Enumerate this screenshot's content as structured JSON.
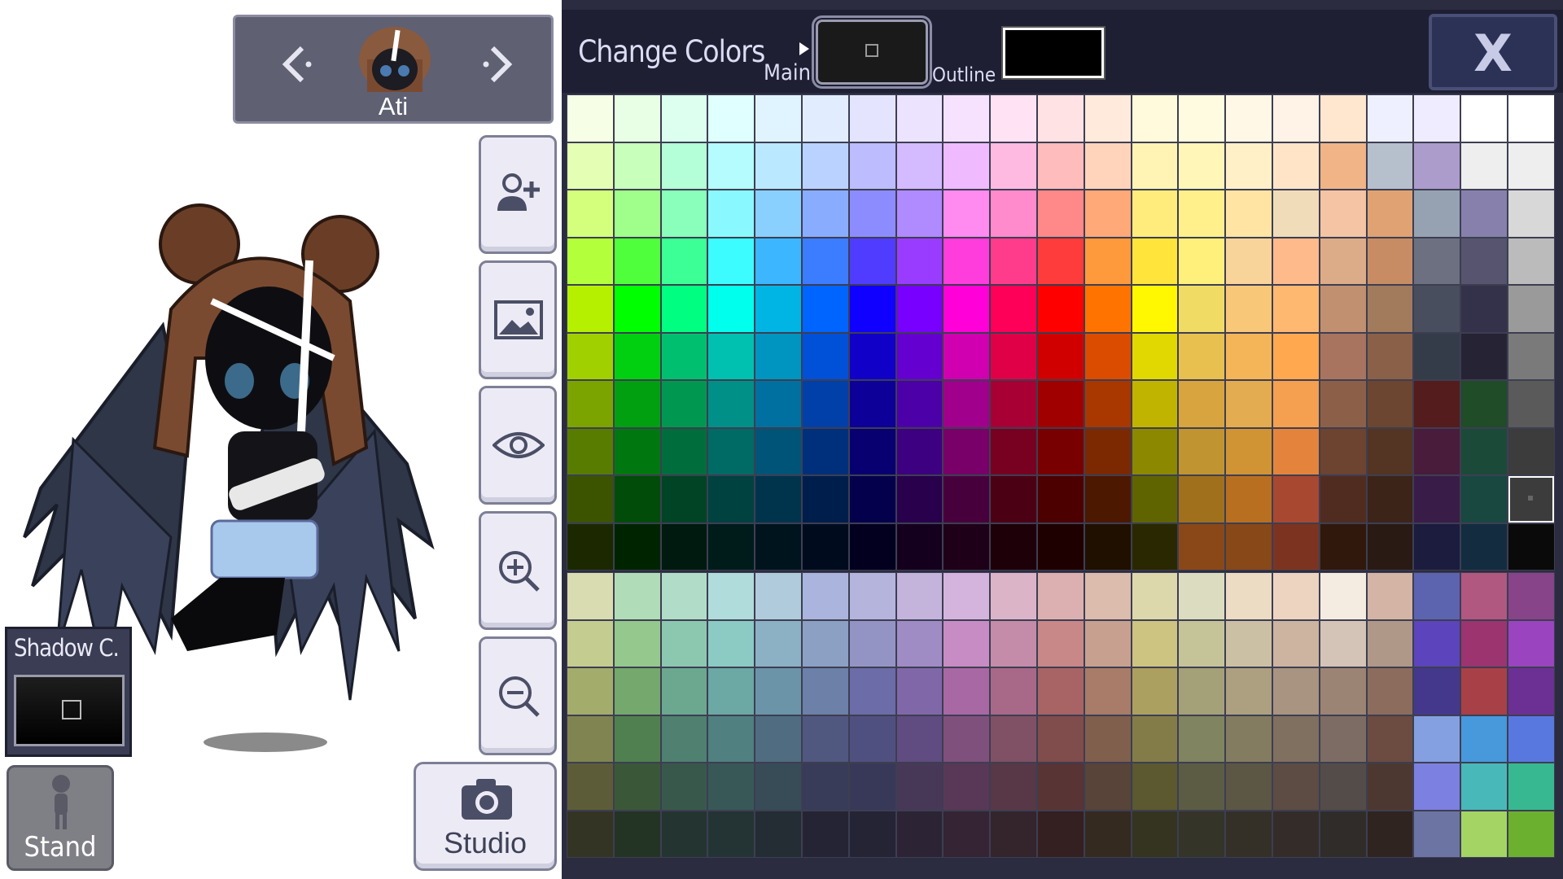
{
  "character_nav": {
    "name": "Ati"
  },
  "side_tools": [
    "add-character",
    "background",
    "visibility",
    "zoom-in",
    "zoom-out"
  ],
  "studio": {
    "label": "Studio"
  },
  "shadow": {
    "label": "Shadow C.",
    "color": "#000000"
  },
  "stand": {
    "label": "Stand"
  },
  "color_panel": {
    "title": "Change Colors",
    "main_label": "Main",
    "main_color": "#1a1a1a",
    "outline_label": "Outline",
    "outline_color": "#000000",
    "close_label": "X",
    "selected_color": {
      "row": 8,
      "col": 20
    },
    "palette_rows": [
      [
        "#f6ffe6",
        "#e8ffe6",
        "#dcfff0",
        "#e0ffff",
        "#e0f4ff",
        "#e2ecff",
        "#e4e4ff",
        "#ece4ff",
        "#f6e2ff",
        "#ffe2f4",
        "#ffe2e4",
        "#ffeadc",
        "#fffadc",
        "#fffbe0",
        "#fff8e6",
        "#fff2e6",
        "#ffe6ce",
        "#eef0ff",
        "#f0ecff",
        "#ffffff"
      ],
      [
        "#e4ffb4",
        "#c8ffba",
        "#b4ffd8",
        "#b4fcff",
        "#bae8ff",
        "#bad2ff",
        "#bcbcff",
        "#d4baff",
        "#f0baff",
        "#ffbae2",
        "#ffbcbc",
        "#ffd4ba",
        "#fff4b4",
        "#fff6b8",
        "#fff0c8",
        "#ffe4c8",
        "#f0b486",
        "#b6bfcc",
        "#ac9ccc",
        "#eeeeee"
      ],
      [
        "#d4ff7c",
        "#a0ff8a",
        "#8affbc",
        "#8af8ff",
        "#8ad0ff",
        "#8aacff",
        "#8c8cff",
        "#b08aff",
        "#ff8af0",
        "#ff8acc",
        "#ff8888",
        "#ffa878",
        "#ffec7c",
        "#fff08c",
        "#ffe4a4",
        "#f0dcb8",
        "#f4c4a4",
        "#e0a272",
        "#96a2b2",
        "#8880ac"
      ],
      [
        "#b4ff3c",
        "#50ff3c",
        "#3cff96",
        "#3cfcff",
        "#3cb6ff",
        "#3c7cff",
        "#503cff",
        "#9a3cff",
        "#ff3cdc",
        "#ff3c8c",
        "#ff3c3c",
        "#ff9a3c",
        "#ffe43c",
        "#fff07c",
        "#f8d49a",
        "#ffba8c",
        "#dcac88",
        "#c88c64",
        "#6c7080",
        "#56546e"
      ],
      [
        "#b4f000",
        "#00ff00",
        "#00ff80",
        "#00ffec",
        "#00b4e4",
        "#0064ff",
        "#1000ff",
        "#7800ff",
        "#ff00d8",
        "#ff0058",
        "#ff0000",
        "#ff7400",
        "#fff800",
        "#f0dc64",
        "#f8c878",
        "#ffb870",
        "#c09070",
        "#a27a5c",
        "#484e5e",
        "#34324a"
      ],
      [
        "#a0d000",
        "#00d010",
        "#00c070",
        "#00c0b0",
        "#0094c0",
        "#0050d8",
        "#1000c8",
        "#6400d0",
        "#d000b0",
        "#e00048",
        "#d00000",
        "#dc4c00",
        "#e0d800",
        "#e8c050",
        "#f4b458",
        "#ffa850",
        "#a87460",
        "#8a6048",
        "#343c4a",
        "#262434"
      ],
      [
        "#7ca400",
        "#00a010",
        "#009850",
        "#009088",
        "#0070a0",
        "#0040a8",
        "#0c0098",
        "#4c00a8",
        "#a0008c",
        "#a80034",
        "#a00000",
        "#a83800",
        "#c0b400",
        "#d8a440",
        "#e4ac50",
        "#f4a050",
        "#8c6048",
        "#6c4630",
        "#541c1c",
        "#204c28"
      ],
      [
        "#587c00",
        "#007810",
        "#006e3c",
        "#006a64",
        "#005478",
        "#00307c",
        "#080070",
        "#3c0080",
        "#780068",
        "#780020",
        "#780000",
        "#7c2800",
        "#8c8800",
        "#c09430",
        "#d09434",
        "#e4843c",
        "#6c4430",
        "#543422",
        "#4a1c3c",
        "#1c4a38"
      ],
      [
        "#3c5400",
        "#004c08",
        "#004426",
        "#004240",
        "#00344c",
        "#001e4c",
        "#04004c",
        "#28004c",
        "#48003c",
        "#4c0014",
        "#4c0000",
        "#4c1800",
        "#606400",
        "#a0701c",
        "#b87020",
        "#a84830",
        "#502c20",
        "#3c2418",
        "#3a1c48",
        "#184840"
      ],
      [
        "#1c2800",
        "#002400",
        "#001a10",
        "#001c1a",
        "#00141e",
        "#000c1e",
        "#02001e",
        "#14001e",
        "#1e0018",
        "#1e0008",
        "#1e0000",
        "#201000",
        "#2a2800",
        "#8a4818",
        "#884818",
        "#7c3420",
        "#30180c",
        "#2a1a14",
        "#1c1c3e",
        "#142c40"
      ],
      [
        "#d8dcb0",
        "#b0dcb8",
        "#b0dcc8",
        "#b0dcdc",
        "#b0ccdc",
        "#aab4dc",
        "#b4b4dc",
        "#c4b4dc",
        "#d4b4dc",
        "#dcb4c8",
        "#dcb0b0",
        "#dcbcac",
        "#dcd8ac",
        "#dcdcc0",
        "#ecdcc4",
        "#ecd4c0",
        "#f4ece0",
        "#d4b4a4",
        "#5c64b0",
        "#b05880"
      ],
      [
        "#c4cc90",
        "#94c88c",
        "#8cc8b0",
        "#8ccac4",
        "#8cb0c4",
        "#8ca0c4",
        "#9494c4",
        "#a08cc4",
        "#c88cc4",
        "#c48ca8",
        "#c88888",
        "#c8a090",
        "#ccc480",
        "#c4c498",
        "#ccc0a4",
        "#ccb4a0",
        "#d4c4b8",
        "#b09888",
        "#5c44bc",
        "#9c3470"
      ],
      [
        "#a4ac6c",
        "#74a86c",
        "#6ca890",
        "#6ca8a4",
        "#6c94a8",
        "#6c80a8",
        "#6c6ca8",
        "#8068a8",
        "#a868a4",
        "#a86888",
        "#a86464",
        "#a87c68",
        "#aca060",
        "#a4a078",
        "#aca080",
        "#a89480",
        "#9c8474",
        "#8c6c5c",
        "#44388c",
        "#a84048"
      ],
      [
        "#808450",
        "#508050",
        "#508070",
        "#508080",
        "#506c80",
        "#505880",
        "#505080",
        "#604c80",
        "#80507c",
        "#805064",
        "#804c4c",
        "#80604c",
        "#847c48",
        "#808460",
        "#847c60",
        "#807060",
        "#7c6c64",
        "#6c4c40",
        "#84a0e0",
        "#4898dc"
      ],
      [
        "#5c5c38",
        "#3a5838",
        "#38584c",
        "#385858",
        "#384c58",
        "#383c58",
        "#383858",
        "#483858",
        "#583856",
        "#583846",
        "#583434",
        "#584438",
        "#5c5830",
        "#5c5c44",
        "#5c5644",
        "#5c4c44",
        "#544c48",
        "#4c3830",
        "#7c80e0",
        "#48b8b8"
      ],
      [
        "#343424",
        "#243424",
        "#243430",
        "#243434",
        "#242c34",
        "#242434",
        "#242434",
        "#2c2434",
        "#342434",
        "#34242c",
        "#342020",
        "#342a20",
        "#343420",
        "#343428",
        "#343028",
        "#342c28",
        "#302c2a",
        "#302420",
        "#6c74a4",
        "#a4d464"
      ]
    ],
    "palette_last_col": [
      "#ffffff",
      "#eeeeee",
      "#d8d8d8",
      "#bbbbbb",
      "#9a9a9a",
      "#7a7a7a",
      "#5a5a5a",
      "#3c3c3c",
      "#3c3c3c",
      "#0a0a0a",
      "#884488",
      "#9a44c0",
      "#6c3094",
      "#5878e0",
      "#38b890",
      "#6cb030"
    ]
  }
}
